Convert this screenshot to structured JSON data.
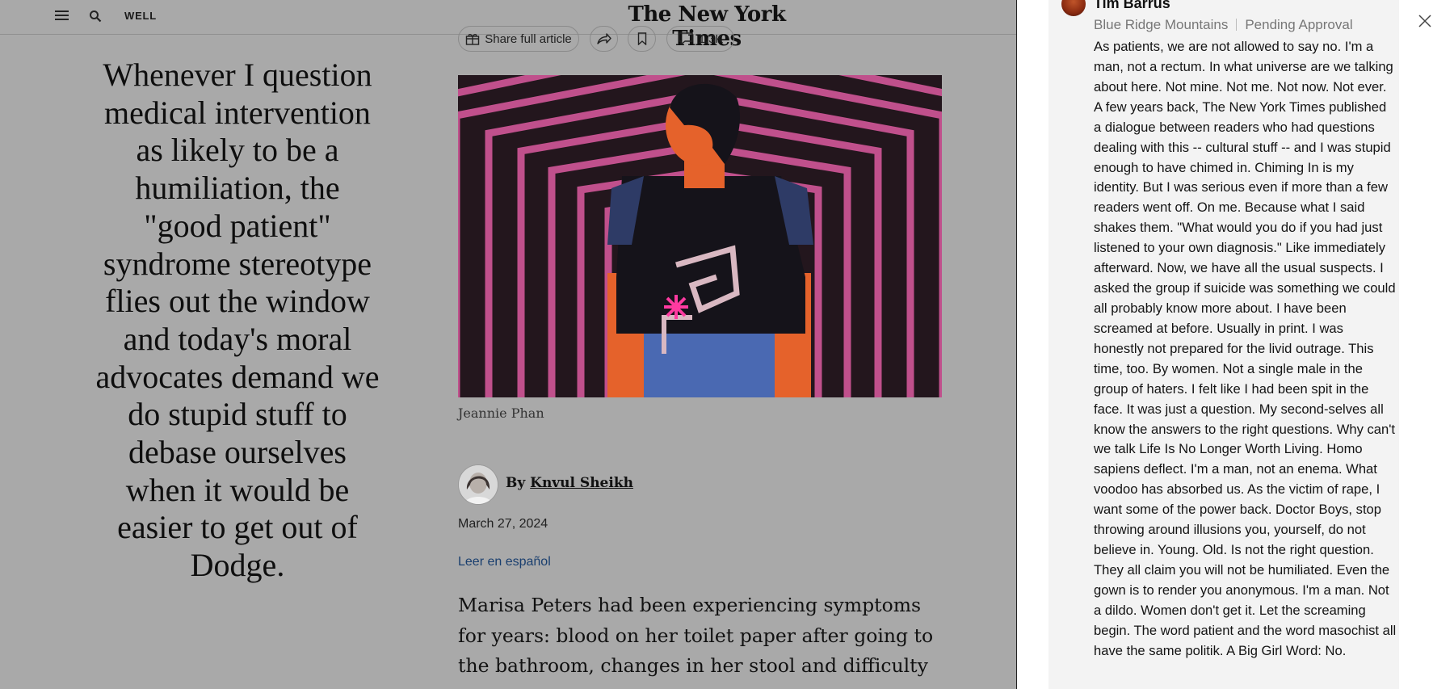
{
  "header": {
    "section": "WELL",
    "masthead": "The New York Times"
  },
  "pull_quote": "Whenever I question medical intervention as likely to be a humiliation, the \"good patient\" syndrome stereotype flies out the window and today's moral advocates demand we do stupid stuff to debase ourselves when it would be easier to get out of Dodge.",
  "toolbar": {
    "share_label": "Share full article",
    "comment_count": "1.3K"
  },
  "article": {
    "image_credit": "Jeannie Phan",
    "byline_prefix": "By",
    "author": "Knvul Sheikh",
    "date": "March 27, 2024",
    "translate_link": "Leer en español",
    "body": "Marisa Peters had been experiencing symptoms for years: blood on her toilet paper after going to the bathroom, changes in her stool and difficulty"
  },
  "comment": {
    "name": "Tim Barrus",
    "location": "Blue Ridge Mountains",
    "status": "Pending Approval",
    "text": "As patients, we are not allowed to say no. I'm a man, not a rectum. In what universe are we talking about here. Not mine. Not me. Not now. Not ever. A few years back, The New York Times published a dialogue between readers who had questions dealing with this -- cultural stuff -- and I was stupid enough to have chimed in. Chiming In is my identity. But I was serious even if more than a few readers went off. On me. Because what I said shakes them. \"What would you do if you had just listened to your own diagnosis.\" Like immediately afterward. Now, we have all the usual suspects. I asked the group if suicide was something we could all probably know more about. I have been screamed at before. Usually in print. I was honestly not prepared for the livid outrage. This time, too. By women. Not a single male in the group of haters. I felt like I had been spit in the face. It was just a question. My second-selves all know the answers to the right questions. Why can't we talk Life Is No Longer Worth Living. Homo sapiens deflect. I'm a man, not an enema. What voodoo has absorbed us. As the victim of rape, I want some of the power back. Doctor Boys, stop throwing around illusions you, yourself, do not believe in. Young. Old. Is not the right question. They all claim you will not be humiliated. Even the gown is to render you anonymous. I'm a man. Not a dildo. Women don't get it. Let the screaming begin. The word patient and the word masochist all have the same politik. A Big Girl Word: No."
  },
  "icons": [
    "menu-icon",
    "search-icon",
    "gift-icon",
    "share-icon",
    "bookmark-icon",
    "comment-icon",
    "close-icon"
  ]
}
